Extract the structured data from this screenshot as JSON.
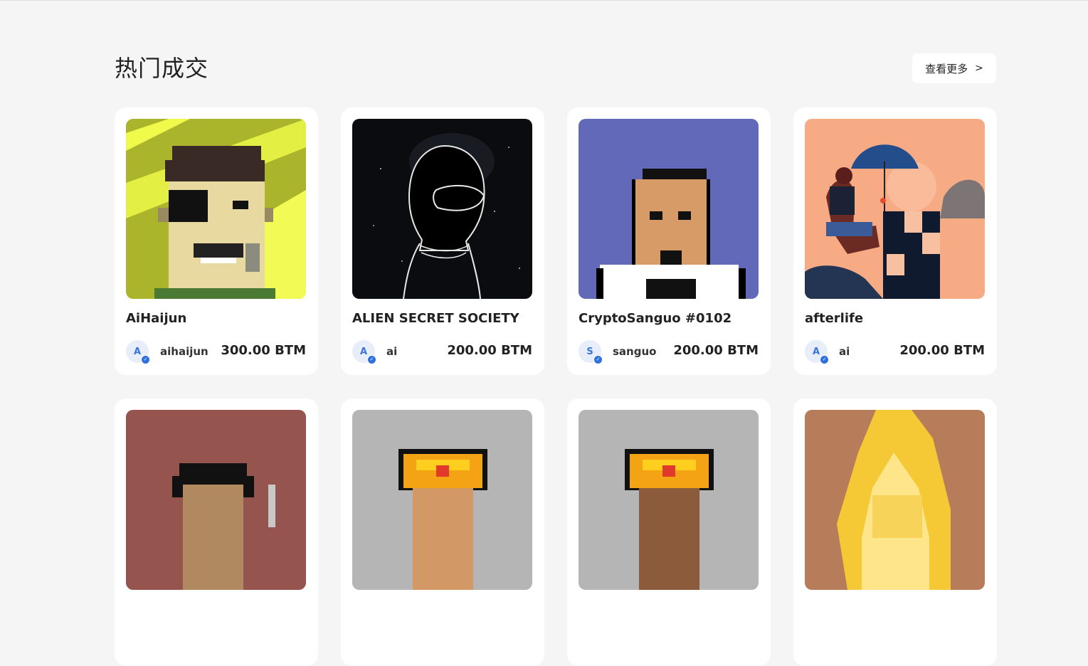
{
  "section": {
    "title": "热门成交",
    "more_label": "查看更多",
    "more_icon": "chevron-right-icon"
  },
  "cards": [
    {
      "name": "AiHaijun",
      "owner": "aihaijun",
      "avatar_letter": "A",
      "price": "300.00 BTM",
      "verified": true
    },
    {
      "name": "ALIEN SECRET SOCIETY",
      "owner": "ai",
      "avatar_letter": "A",
      "price": "200.00 BTM",
      "verified": true
    },
    {
      "name": "CryptoSanguo #0102",
      "owner": "sanguo",
      "avatar_letter": "S",
      "price": "200.00 BTM",
      "verified": true
    },
    {
      "name": "afterlife",
      "owner": "ai",
      "avatar_letter": "A",
      "price": "200.00 BTM",
      "verified": true
    }
  ],
  "colors": {
    "page_bg": "#f5f5f5",
    "card_bg": "#ffffff",
    "verified_badge": "#2f6fe0",
    "avatar_bg": "#e8eef9"
  }
}
